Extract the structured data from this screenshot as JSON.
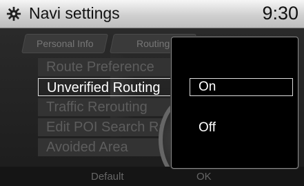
{
  "header": {
    "title": "Navi settings",
    "time": "9:30",
    "icon": "gear-icon"
  },
  "tabs": [
    {
      "label": "Personal Info"
    },
    {
      "label": "Routing"
    }
  ],
  "menu": [
    {
      "label": "Route Preference"
    },
    {
      "label": "Unverified Routing"
    },
    {
      "label": "Traffic Rerouting"
    },
    {
      "label": "Edit POI Search Rad"
    },
    {
      "label": "Avoided Area"
    }
  ],
  "popup": {
    "options": [
      {
        "label": "On"
      },
      {
        "label": "Off"
      }
    ]
  },
  "bottom": {
    "default_label": "Default",
    "ok_label": "OK"
  }
}
